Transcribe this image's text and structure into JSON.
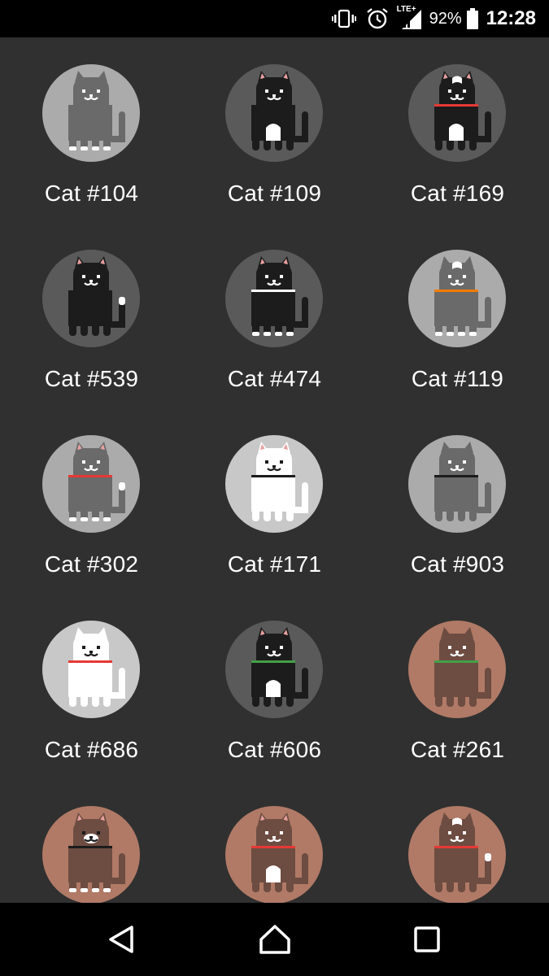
{
  "status_bar": {
    "battery_percent": "92%",
    "time": "12:28",
    "network_label": "LTE+",
    "icons": [
      "vibrate-icon",
      "alarm-icon",
      "signal-icon",
      "battery-icon"
    ]
  },
  "cats": [
    {
      "name": "Cat #104",
      "bg": "#ababab",
      "body": "#6a6a6a",
      "belly": null,
      "collar": null,
      "tail_tip": false,
      "paws": true,
      "face_patch": false,
      "head_patch": false,
      "ears": "#6a6a6a"
    },
    {
      "name": "Cat #109",
      "bg": "#5a5a5a",
      "body": "#1c1c1c",
      "belly": "#ffffff",
      "collar": null,
      "tail_tip": false,
      "paws": false,
      "face_patch": false,
      "head_patch": false,
      "ears": "#e8a0a0"
    },
    {
      "name": "Cat #169",
      "bg": "#5a5a5a",
      "body": "#1c1c1c",
      "belly": "#ffffff",
      "collar": "#e53935",
      "tail_tip": false,
      "paws": false,
      "face_patch": false,
      "head_patch": true,
      "ears": "#e8a0a0"
    },
    {
      "name": "Cat #539",
      "bg": "#5a5a5a",
      "body": "#1c1c1c",
      "belly": null,
      "collar": null,
      "tail_tip": true,
      "paws": false,
      "face_patch": false,
      "head_patch": false,
      "ears": "#e8a0a0"
    },
    {
      "name": "Cat #474",
      "bg": "#5a5a5a",
      "body": "#1c1c1c",
      "belly": null,
      "collar": "#ffffff",
      "tail_tip": false,
      "paws": true,
      "face_patch": false,
      "head_patch": false,
      "ears": "#e8a0a0"
    },
    {
      "name": "Cat #119",
      "bg": "#ababab",
      "body": "#6a6a6a",
      "belly": null,
      "collar": "#f57c00",
      "tail_tip": false,
      "paws": true,
      "face_patch": false,
      "head_patch": true,
      "ears": "#6a6a6a"
    },
    {
      "name": "Cat #302",
      "bg": "#ababab",
      "body": "#6a6a6a",
      "belly": null,
      "collar": "#e53935",
      "tail_tip": true,
      "paws": true,
      "face_patch": false,
      "head_patch": false,
      "ears": "#e8a0a0"
    },
    {
      "name": "Cat #171",
      "bg": "#c8c8c8",
      "body": "#ffffff",
      "belly": null,
      "collar": "#1c1c1c",
      "tail_tip": false,
      "paws": false,
      "face_patch": false,
      "head_patch": false,
      "ears": "#e8a0a0"
    },
    {
      "name": "Cat #903",
      "bg": "#ababab",
      "body": "#6a6a6a",
      "belly": null,
      "collar": "#1c1c1c",
      "tail_tip": false,
      "paws": false,
      "face_patch": false,
      "head_patch": false,
      "ears": "#6a6a6a"
    },
    {
      "name": "Cat #686",
      "bg": "#c8c8c8",
      "body": "#ffffff",
      "belly": null,
      "collar": "#e53935",
      "tail_tip": false,
      "paws": false,
      "face_patch": false,
      "head_patch": false,
      "ears": "#ffffff"
    },
    {
      "name": "Cat #606",
      "bg": "#5a5a5a",
      "body": "#1c1c1c",
      "belly": "#ffffff",
      "collar": "#43a047",
      "tail_tip": false,
      "paws": false,
      "face_patch": false,
      "head_patch": false,
      "ears": "#e8a0a0"
    },
    {
      "name": "Cat #261",
      "bg": "#b07a66",
      "body": "#6d4c41",
      "belly": null,
      "collar": "#43a047",
      "tail_tip": false,
      "paws": false,
      "face_patch": false,
      "head_patch": false,
      "ears": "#6d4c41"
    },
    {
      "name": "",
      "bg": "#b07a66",
      "body": "#6d4c41",
      "belly": null,
      "collar": "#1c1c1c",
      "tail_tip": false,
      "paws": true,
      "face_patch": true,
      "head_patch": false,
      "ears": "#e8a0a0"
    },
    {
      "name": "",
      "bg": "#b07a66",
      "body": "#6d4c41",
      "belly": "#ffffff",
      "collar": "#e53935",
      "tail_tip": false,
      "paws": false,
      "face_patch": false,
      "head_patch": false,
      "ears": "#e8a0a0"
    },
    {
      "name": "",
      "bg": "#b07a66",
      "body": "#6d4c41",
      "belly": null,
      "collar": "#e53935",
      "tail_tip": true,
      "paws": false,
      "face_patch": false,
      "head_patch": true,
      "ears": "#6d4c41"
    }
  ],
  "nav_bar": {
    "buttons": [
      "back",
      "home",
      "recents"
    ]
  }
}
